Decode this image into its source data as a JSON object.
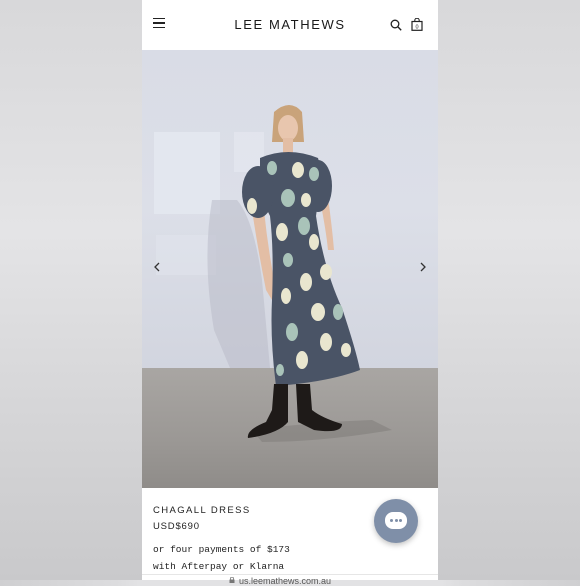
{
  "header": {
    "brand": "LEE MATHEWS",
    "menu_icon": "hamburger-menu-icon",
    "search_icon": "search-icon",
    "bag_icon": "shopping-bag-icon",
    "bag_count": "0"
  },
  "gallery": {
    "prev_icon": "chevron-left-icon",
    "next_icon": "chevron-right-icon",
    "image_alt": "Model wearing navy dress with pale green and cream brushstroke print"
  },
  "product": {
    "name": "CHAGALL DRESS",
    "price": "USD$690",
    "installments_line1": "or four payments of $173",
    "installments_line2": "with Afterpay or Klarna"
  },
  "browser": {
    "url": "us.leemathews.com.au"
  },
  "chat": {
    "icon": "chat-bubble-icon",
    "color": "#7f8fa8"
  }
}
